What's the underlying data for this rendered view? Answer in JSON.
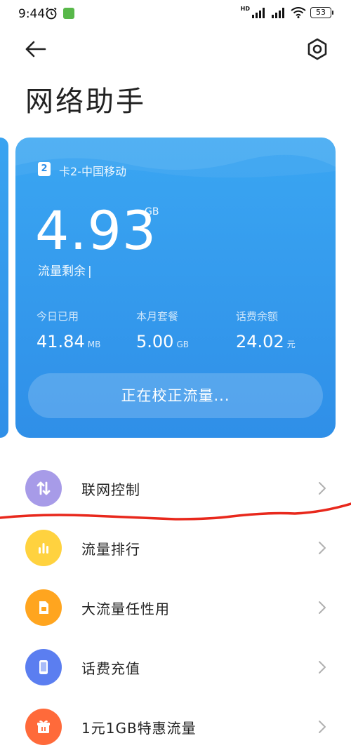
{
  "status_bar": {
    "time": "9:44",
    "hd_label": "HD",
    "battery": "53",
    "icons": [
      "alarm-icon",
      "app-notification-icon",
      "signal-icon",
      "signal-icon",
      "wifi-icon",
      "battery-icon"
    ]
  },
  "header": {
    "back_icon": "back-arrow-icon",
    "settings_icon": "gear-icon",
    "title": "网络助手"
  },
  "card": {
    "sim_badge": "2",
    "sim_label": "卡2-中国移动",
    "remaining_value": "4.93",
    "remaining_unit": "GB",
    "remaining_label": "流量剩余",
    "stats": [
      {
        "label": "今日已用",
        "value": "41.84",
        "unit": "MB"
      },
      {
        "label": "本月套餐",
        "value": "5.00",
        "unit": "GB"
      },
      {
        "label": "话费余额",
        "value": "24.02",
        "unit": "元"
      }
    ],
    "calibrate_button": "正在校正流量...",
    "colors": {
      "card_top": "#3aa6f2",
      "card_bottom": "#2f8fe8"
    }
  },
  "menu": [
    {
      "label": "联网控制",
      "icon": "network-control-icon",
      "color": "#a79be8"
    },
    {
      "label": "流量排行",
      "icon": "bar-chart-icon",
      "color": "#ffd23f"
    },
    {
      "label": "大流量任性用",
      "icon": "sim-card-icon",
      "color": "#ffa51f"
    },
    {
      "label": "话费充值",
      "icon": "phone-icon",
      "color": "#5b7ef0"
    },
    {
      "label": "1元1GB特惠流量",
      "icon": "gift-icon",
      "color": "#ff6a3a"
    }
  ],
  "annotation": {
    "color": "#e8281c"
  }
}
